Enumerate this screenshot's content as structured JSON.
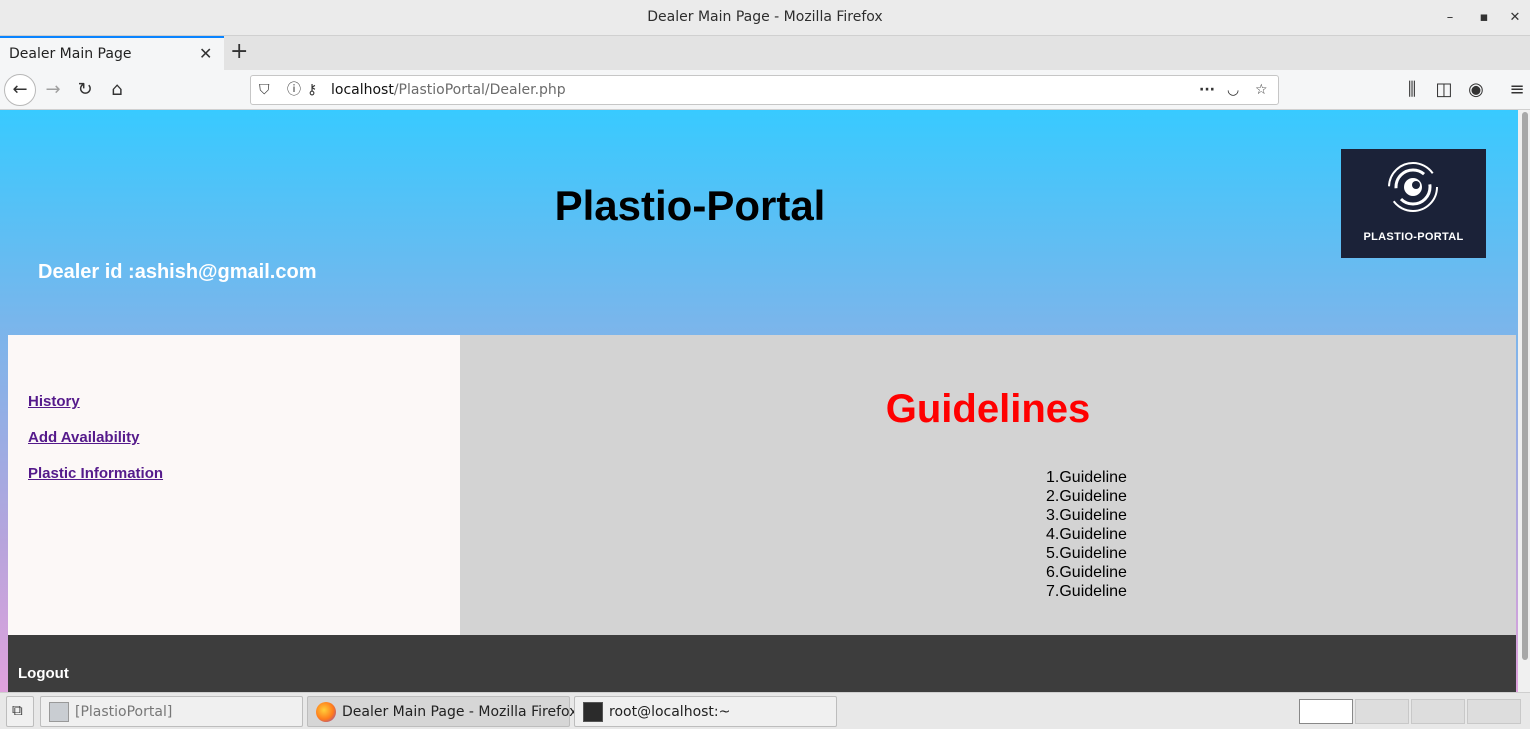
{
  "window": {
    "title": "Dealer Main Page - Mozilla Firefox",
    "minimize_glyph": "–",
    "maximize_glyph": "▪",
    "close_glyph": "✕"
  },
  "browser": {
    "tab_label": "Dealer Main Page",
    "url_host": "localhost",
    "url_path": "/PlastioPortal/Dealer.php"
  },
  "header": {
    "site_title": "Plastio-Portal",
    "dealer_id": "Dealer id :ashish@gmail.com",
    "logo_text": "PLASTIO-PORTAL"
  },
  "sidebar": {
    "links": [
      "History",
      "Add Availability",
      "Plastic Information"
    ]
  },
  "main": {
    "heading": "Guidelines",
    "guidelines": [
      "1.Guideline",
      "2.Guideline",
      "3.Guideline",
      "4.Guideline",
      "5.Guideline",
      "6.Guideline",
      "7.Guideline"
    ],
    "heading_color": "#ff0000"
  },
  "footer": {
    "logout": "Logout"
  },
  "taskbar": {
    "tasks": [
      "[PlastioPortal]",
      "Dealer Main Page - Mozilla Firefox",
      "root@localhost:~"
    ]
  }
}
